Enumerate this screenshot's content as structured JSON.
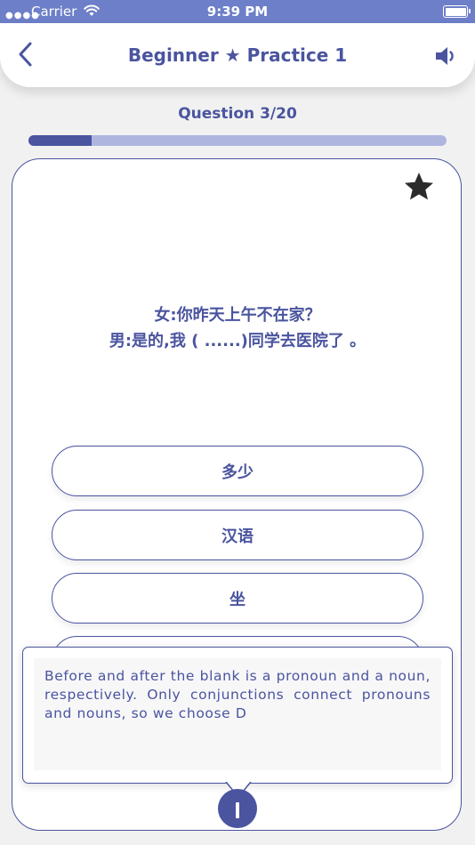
{
  "status_bar": {
    "carrier": "Carrier",
    "time": "9:39 PM",
    "signal_icon": "signal-dots-icon",
    "wifi_icon": "wifi-icon",
    "battery_icon": "battery-icon"
  },
  "header": {
    "title": "Beginner ★ Practice 1",
    "back_icon": "chevron-left-icon",
    "sound_icon": "speaker-icon"
  },
  "progress": {
    "label": "Question 3/20",
    "current": 3,
    "total": 20
  },
  "card": {
    "bookmark_icon": "star-icon",
    "question_lines": [
      "女:你昨天上午不在家？",
      "男:是的,我 ( ......)同学去医院了 。"
    ],
    "options": [
      "多少",
      "汉语",
      "坐",
      ""
    ]
  },
  "explanation": {
    "text": "Before and after the blank is a pronoun and a noun, respectively. Only conjunctions connect pronouns and nouns, so we choose D",
    "info_icon": "info-icon"
  },
  "colors": {
    "accent": "#4a549f",
    "status_bar": "#6d7fc8",
    "progress_track": "#aeb6e0",
    "background": "#f1f1f1"
  }
}
